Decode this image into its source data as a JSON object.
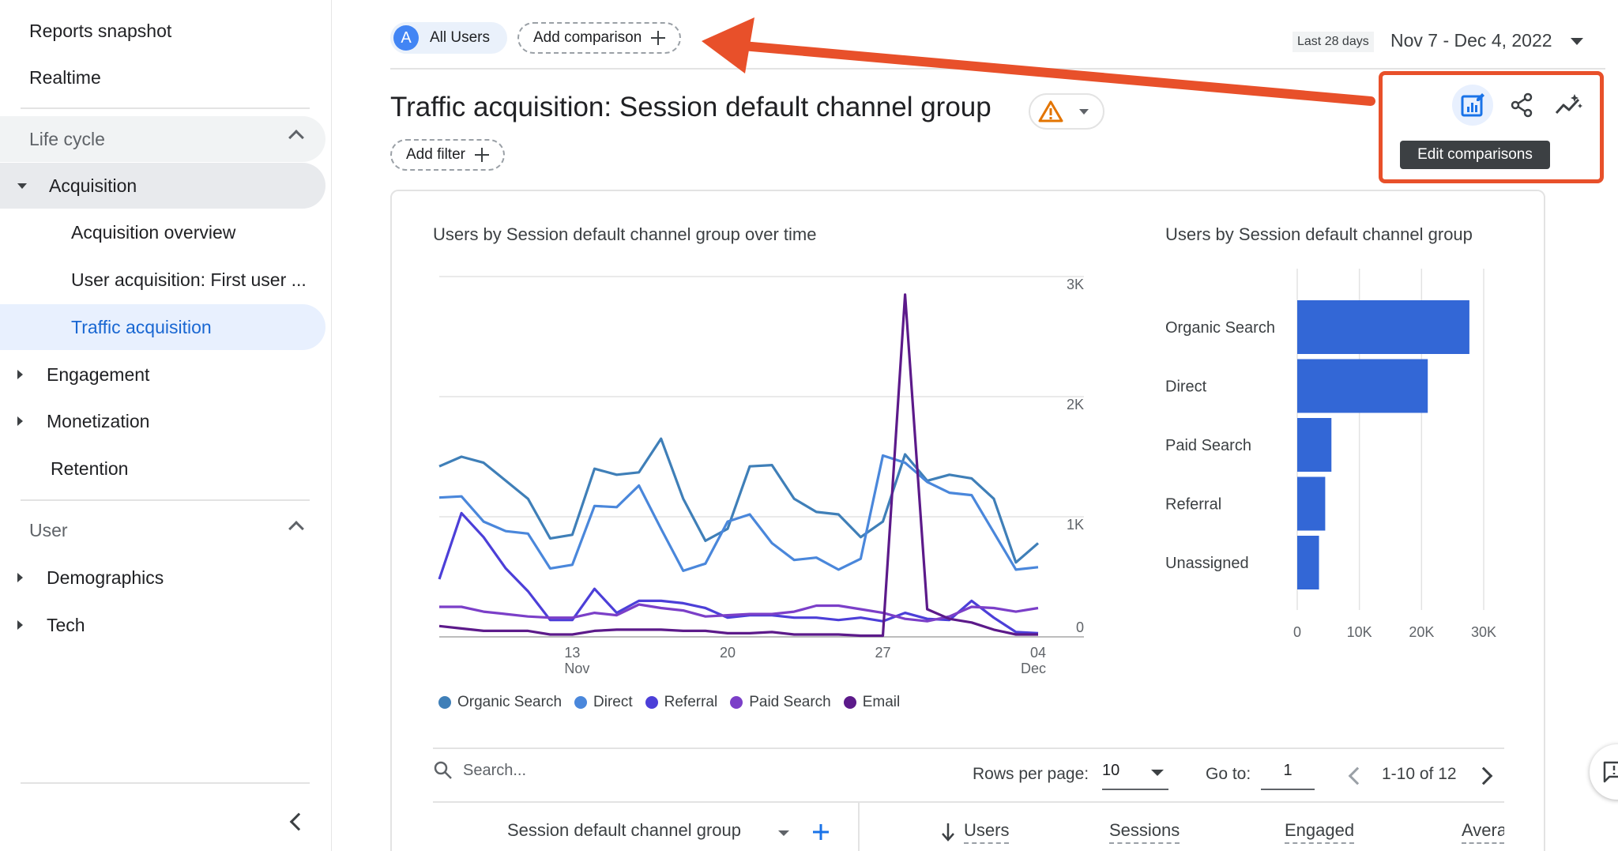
{
  "sidebar": {
    "reports_snapshot": "Reports snapshot",
    "realtime": "Realtime",
    "lifecycle_section": "Life cycle",
    "acquisition": "Acquisition",
    "acquisition_overview": "Acquisition overview",
    "user_acquisition": "User acquisition: First user ...",
    "traffic_acquisition": "Traffic acquisition",
    "engagement": "Engagement",
    "monetization": "Monetization",
    "retention": "Retention",
    "user_section": "User",
    "demographics": "Demographics",
    "tech": "Tech"
  },
  "topbar": {
    "avatar_letter": "A",
    "all_users": "All Users",
    "add_comparison": "Add comparison",
    "date_range_label": "Last 28 days",
    "date_range": "Nov 7 - Dec 4, 2022"
  },
  "page": {
    "title": "Traffic acquisition: Session default channel group",
    "add_filter": "Add filter",
    "tooltip": "Edit comparisons"
  },
  "colors": {
    "accent": "#1a73e8",
    "annotation": "#e8502a",
    "organic_search": "#3f7fb8",
    "direct": "#4a87db",
    "referral": "#4c3fd8",
    "paid_search": "#7b3fc8",
    "email": "#5c1a8a",
    "bar": "#3367d6"
  },
  "chart_data": [
    {
      "type": "line",
      "title": "Users by Session default channel group over time",
      "x": [
        "Nov 7",
        "Nov 8",
        "Nov 9",
        "Nov 10",
        "Nov 11",
        "Nov 12",
        "Nov 13",
        "Nov 14",
        "Nov 15",
        "Nov 16",
        "Nov 17",
        "Nov 18",
        "Nov 19",
        "Nov 20",
        "Nov 21",
        "Nov 22",
        "Nov 23",
        "Nov 24",
        "Nov 25",
        "Nov 26",
        "Nov 27",
        "Nov 28",
        "Nov 29",
        "Nov 30",
        "Dec 1",
        "Dec 2",
        "Dec 3",
        "Dec 4"
      ],
      "x_tick_labels": [
        {
          "index": 6,
          "line1": "13",
          "line2": "Nov"
        },
        {
          "index": 13,
          "line1": "20",
          "line2": ""
        },
        {
          "index": 20,
          "line1": "27",
          "line2": ""
        },
        {
          "index": 27,
          "line1": "04",
          "line2": "Dec"
        }
      ],
      "y_ticks": [
        "0",
        "1K",
        "2K",
        "3K"
      ],
      "ylim": [
        0,
        3000
      ],
      "series": [
        {
          "name": "Organic Search",
          "values": [
            1420,
            1500,
            1450,
            1300,
            1150,
            820,
            850,
            1400,
            1350,
            1370,
            1650,
            1150,
            800,
            900,
            1420,
            1430,
            1150,
            1040,
            1020,
            830,
            960,
            1520,
            1300,
            1350,
            1320,
            1150,
            620,
            780
          ]
        },
        {
          "name": "Direct",
          "values": [
            1160,
            1170,
            960,
            880,
            860,
            570,
            600,
            1090,
            1080,
            1260,
            900,
            550,
            610,
            960,
            1020,
            780,
            640,
            660,
            560,
            650,
            1510,
            1450,
            1290,
            1200,
            1180,
            870,
            560,
            580
          ]
        },
        {
          "name": "Referral",
          "values": [
            480,
            1030,
            830,
            570,
            380,
            140,
            140,
            400,
            200,
            300,
            300,
            280,
            240,
            160,
            180,
            180,
            160,
            160,
            140,
            160,
            130,
            200,
            150,
            140,
            300,
            160,
            40,
            30
          ]
        },
        {
          "name": "Paid Search",
          "values": [
            250,
            250,
            210,
            190,
            170,
            160,
            160,
            200,
            180,
            270,
            240,
            220,
            170,
            180,
            190,
            190,
            210,
            260,
            260,
            230,
            200,
            150,
            130,
            170,
            250,
            240,
            210,
            240
          ]
        },
        {
          "name": "Email",
          "values": [
            90,
            70,
            50,
            50,
            50,
            20,
            20,
            50,
            60,
            60,
            60,
            50,
            50,
            30,
            30,
            40,
            20,
            20,
            20,
            10,
            10,
            2850,
            230,
            150,
            120,
            60,
            20,
            20
          ]
        }
      ],
      "legend": [
        "Organic Search",
        "Direct",
        "Referral",
        "Paid Search",
        "Email"
      ],
      "grid": true
    },
    {
      "type": "bar",
      "orientation": "horizontal",
      "title": "Users by Session default channel group",
      "categories": [
        "Organic Search",
        "Direct",
        "Paid Search",
        "Referral",
        "Unassigned"
      ],
      "values": [
        27700,
        21000,
        5500,
        4500,
        3500
      ],
      "x_ticks": [
        "0",
        "10K",
        "20K",
        "30K"
      ],
      "xlim": [
        0,
        30000
      ],
      "grid": true
    }
  ],
  "table": {
    "search_placeholder": "Search...",
    "rows_per_page_label": "Rows per page:",
    "rows_per_page_value": "10",
    "go_to_label": "Go to:",
    "go_to_value": "1",
    "page_range": "1-10 of 12",
    "dimension_header": "Session default channel group",
    "col_users": "Users",
    "col_sessions": "Sessions",
    "col_engaged": "Engaged",
    "col_average": "Avera"
  }
}
